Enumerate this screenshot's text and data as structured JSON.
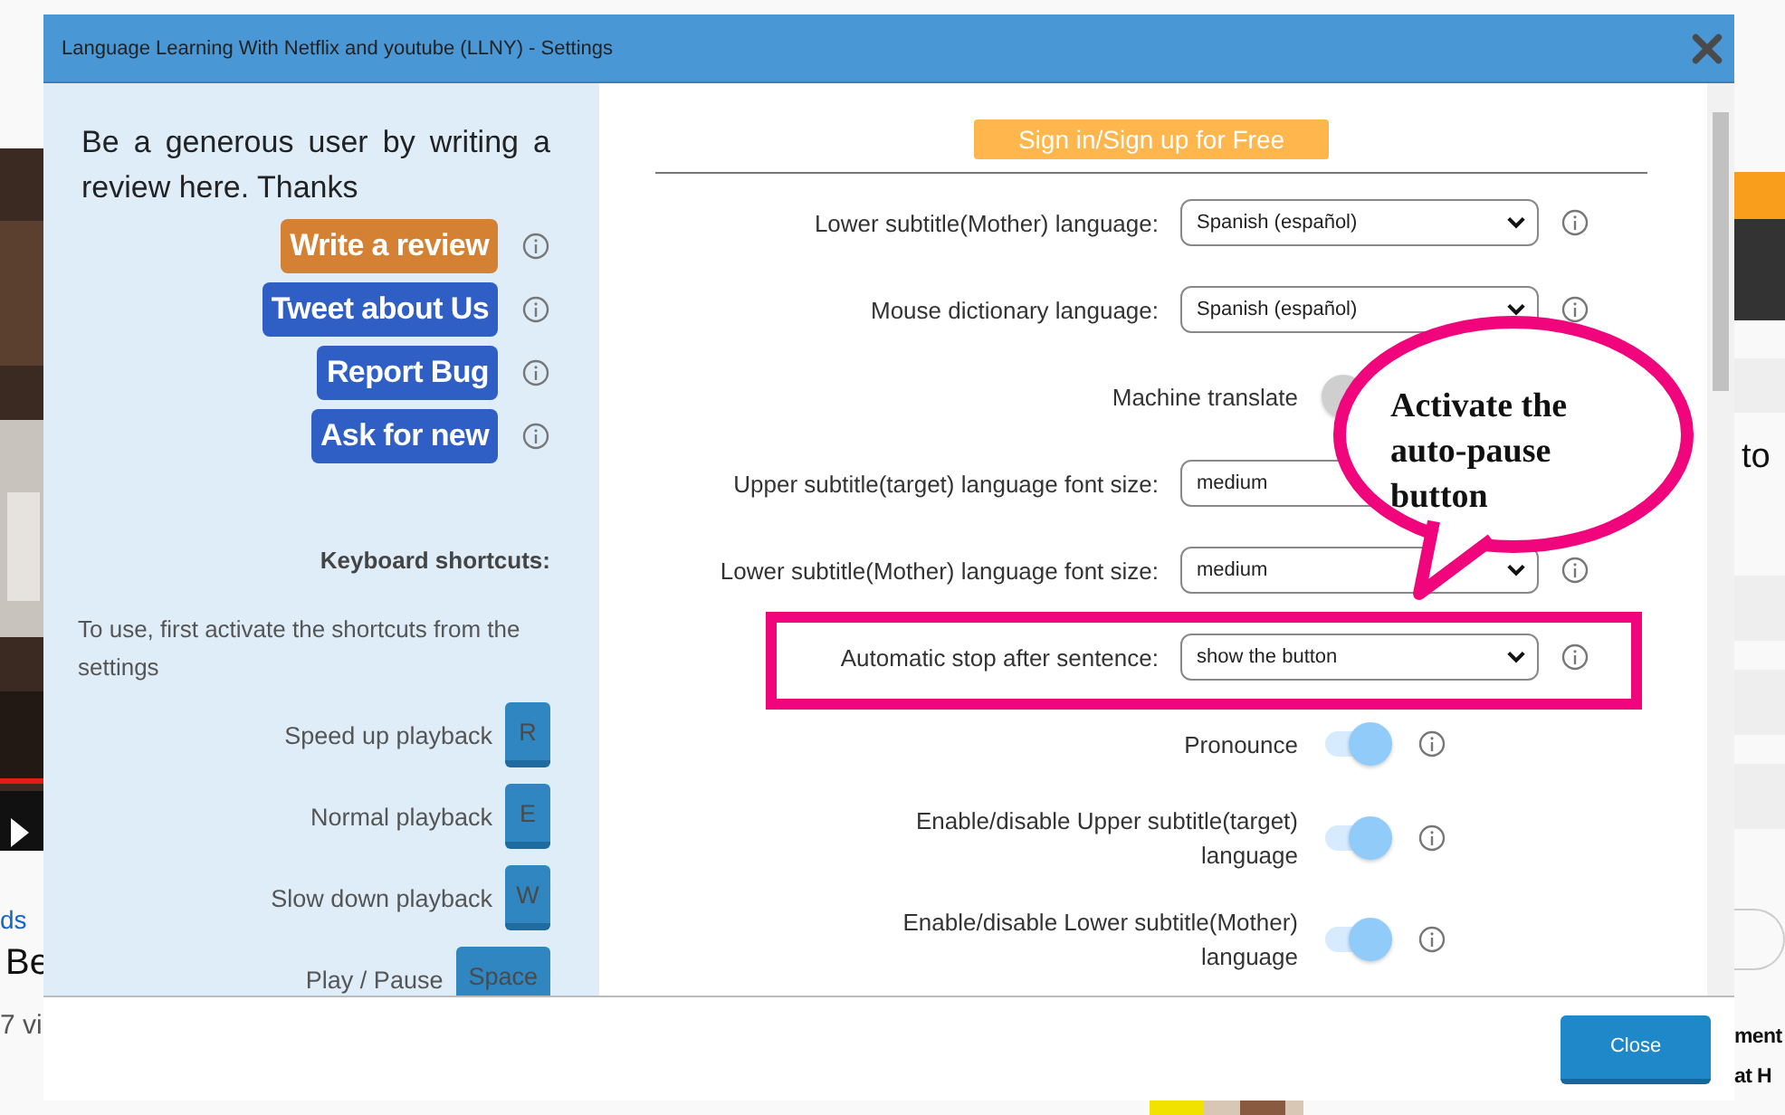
{
  "background": {
    "link_fragment": "ds",
    "title_fragment": "Be",
    "views_fragment": "7 vi",
    "side_fragment": "to",
    "headline_fragments": [
      "ment",
      "at H"
    ]
  },
  "window": {
    "title": "Language Learning With Netflix and youtube (LLNY) - Settings"
  },
  "sidebar": {
    "message": "Be a generous user by writing a review here. Thanks",
    "actions": [
      {
        "label": "Write a review",
        "kind": "review"
      },
      {
        "label": "Tweet about Us",
        "kind": "link"
      },
      {
        "label": "Report Bug",
        "kind": "link"
      },
      {
        "label": "Ask for new",
        "kind": "link"
      }
    ],
    "shortcuts_heading": "Keyboard shortcuts:",
    "shortcuts_note": "To use, first activate the shortcuts from the settings",
    "shortcuts": [
      {
        "action": "Speed up playback",
        "key": "R"
      },
      {
        "action": "Normal playback",
        "key": "E"
      },
      {
        "action": "Slow down playback",
        "key": "W"
      },
      {
        "action": "Play / Pause",
        "key": "Space"
      }
    ]
  },
  "settings": {
    "sign_in": "Sign in/Sign up for Free",
    "rows": [
      {
        "kind": "select",
        "label": "Lower subtitle(Mother) language:",
        "value": "Spanish (español)",
        "info": true,
        "highlighted": false
      },
      {
        "kind": "select",
        "label": "Mouse dictionary language:",
        "value": "Spanish (español)",
        "info": true,
        "highlighted": false
      },
      {
        "kind": "toggle",
        "label": "Machine translate",
        "on": false,
        "info": false,
        "highlighted": false
      },
      {
        "kind": "select",
        "label": "Upper subtitle(target) language font size:",
        "value": "medium",
        "info": false,
        "highlighted": false
      },
      {
        "kind": "select",
        "label": "Lower subtitle(Mother) language font size:",
        "value": "medium",
        "info": true,
        "highlighted": false
      },
      {
        "kind": "select",
        "label": "Automatic stop after sentence:",
        "value": "show the button",
        "info": true,
        "highlighted": true
      },
      {
        "kind": "toggle",
        "label": "Pronounce",
        "on": true,
        "info": true,
        "highlighted": false
      },
      {
        "kind": "toggle",
        "label": "Enable/disable Upper subtitle(target) language",
        "on": true,
        "info": true,
        "highlighted": false
      },
      {
        "kind": "toggle",
        "label": "Enable/disable Lower subtitle(Mother) language",
        "on": true,
        "info": true,
        "highlighted": false
      }
    ]
  },
  "annotation": {
    "callout": "Activate the auto-pause button"
  },
  "footer": {
    "close": "Close"
  }
}
